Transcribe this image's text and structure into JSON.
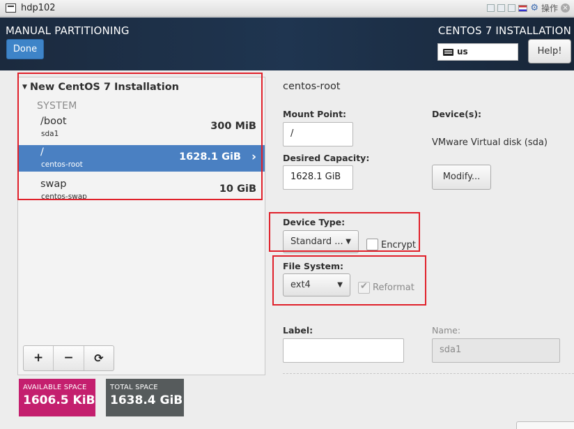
{
  "window": {
    "title": "hdp102",
    "menu_text": "操作"
  },
  "header": {
    "title": "MANUAL PARTITIONING",
    "product": "CENTOS 7 INSTALLATION",
    "done_label": "Done",
    "keyboard_layout": "us",
    "help_label": "Help!"
  },
  "tree": {
    "title": "New CentOS 7 Installation",
    "group": "SYSTEM",
    "items": [
      {
        "name": "/boot",
        "sub": "sda1",
        "size": "300 MiB",
        "selected": false
      },
      {
        "name": "/",
        "sub": "centos-root",
        "size": "1628.1 GiB",
        "selected": true
      },
      {
        "name": "swap",
        "sub": "centos-swap",
        "size": "10 GiB",
        "selected": false
      }
    ]
  },
  "toolbar": {
    "add": "+",
    "remove": "−",
    "refresh": "⟳"
  },
  "space": {
    "available_label": "AVAILABLE SPACE",
    "available_value": "1606.5 KiB",
    "total_label": "TOTAL SPACE",
    "total_value": "1638.4 GiB",
    "available_color": "#c41f6e",
    "total_color": "#565b5c"
  },
  "details": {
    "title": "centos-root",
    "mount_point_label": "Mount Point:",
    "mount_point_value": "/",
    "capacity_label": "Desired Capacity:",
    "capacity_value": "1628.1 GiB",
    "devices_label": "Device(s):",
    "devices_value": "VMware Virtual disk (sda)",
    "modify_label": "Modify...",
    "device_type_label": "Device Type:",
    "device_type_value": "Standard ...",
    "encrypt_label": "Encrypt",
    "encrypt_checked": false,
    "file_system_label": "File System:",
    "file_system_value": "ext4",
    "reformat_label": "Reformat",
    "reformat_checked": true,
    "label_label": "Label:",
    "label_value": "",
    "name_label": "Name:",
    "name_value": "sda1"
  },
  "colors": {
    "header_bg": "#1f3550",
    "selected_row": "#4a80c2",
    "done_button": "#3e84c8",
    "highlight_box": "#e0202a"
  },
  "icons": {
    "window": "window-icon",
    "keyboard": "keyboard-icon",
    "caret": "caret-down-icon",
    "chevron": "chevron-right-icon",
    "dropdown": "dropdown-arrow-icon",
    "checkmark": "checkmark-icon"
  }
}
